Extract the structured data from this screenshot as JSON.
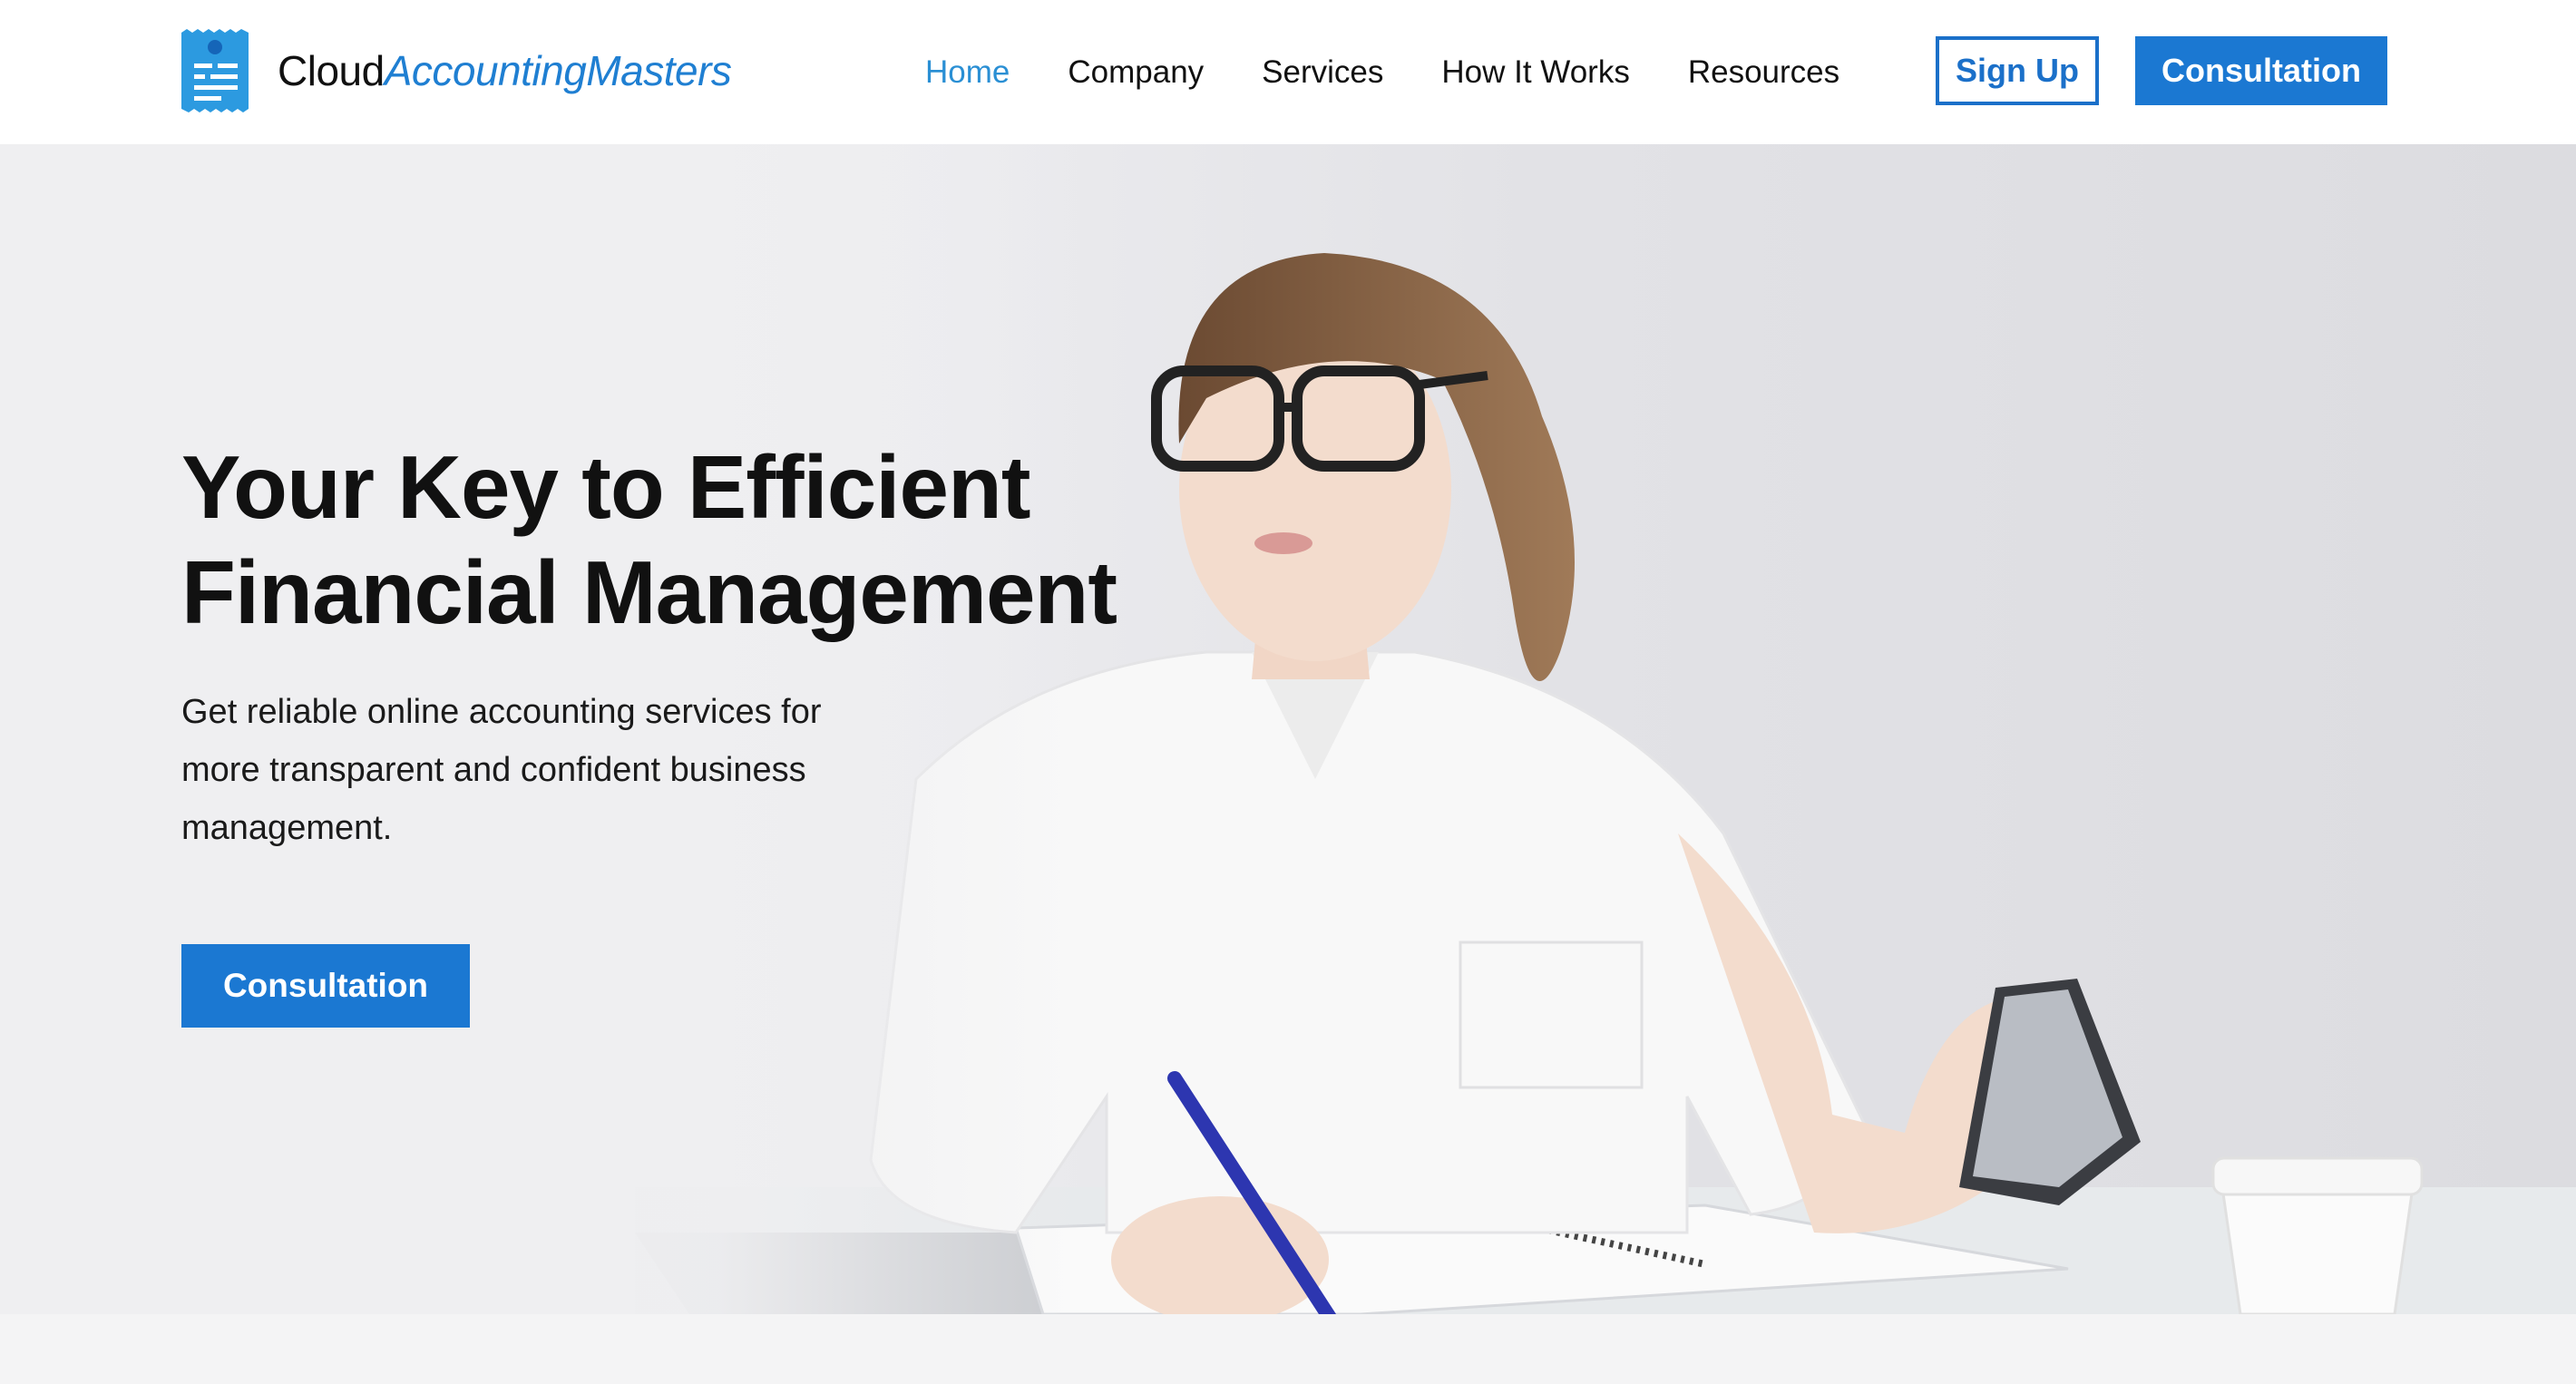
{
  "brand": {
    "name_part1": "Cloud",
    "name_part2": "AccountingMasters",
    "accent": "#1f7fd2"
  },
  "nav": {
    "items": [
      {
        "label": "Home",
        "active": true
      },
      {
        "label": "Company",
        "active": false
      },
      {
        "label": "Services",
        "active": false
      },
      {
        "label": "How It Works",
        "active": false
      },
      {
        "label": "Resources",
        "active": false
      }
    ]
  },
  "header": {
    "signup_label": "Sign Up",
    "consultation_label": "Consultation"
  },
  "hero": {
    "title_line1": "Your Key to Efficient",
    "title_line2": "Financial Management",
    "subtitle_line1": "Get reliable online accounting services for",
    "subtitle_line2": "more transparent and confident business",
    "subtitle_line3": "management.",
    "cta_label": "Consultation",
    "image_icon": "woman-at-desk-photo"
  },
  "colors": {
    "primary_button": "#1b78d2",
    "nav_active": "#2a8fd4",
    "header_bg": "#ffffff"
  }
}
